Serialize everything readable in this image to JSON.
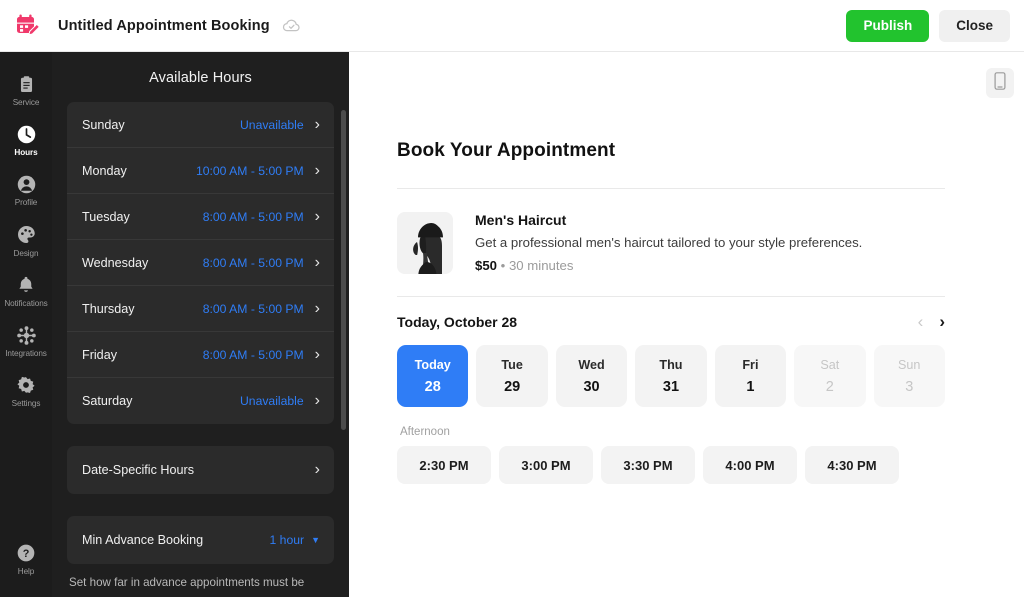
{
  "topbar": {
    "logo_icon": "calendar-edit-icon",
    "title": "Untitled Appointment Booking",
    "saved_icon": "cloud-check-icon",
    "publish_label": "Publish",
    "close_label": "Close",
    "publish_color": "#22c32e"
  },
  "rail": {
    "items": [
      {
        "label": "Service",
        "icon": "clipboard-icon",
        "active": false
      },
      {
        "label": "Hours",
        "icon": "clock-icon",
        "active": true
      },
      {
        "label": "Profile",
        "icon": "person-icon",
        "active": false
      },
      {
        "label": "Design",
        "icon": "palette-icon",
        "active": false
      },
      {
        "label": "Notifications",
        "icon": "bell-icon",
        "active": false
      },
      {
        "label": "Integrations",
        "icon": "integrations-icon",
        "active": false
      },
      {
        "label": "Settings",
        "icon": "gear-icon",
        "active": false
      }
    ],
    "help": {
      "label": "Help",
      "icon": "question-circle-icon"
    }
  },
  "panel": {
    "title": "Available Hours",
    "days": [
      {
        "name": "Sunday",
        "value": "Unavailable"
      },
      {
        "name": "Monday",
        "value": "10:00 AM - 5:00 PM"
      },
      {
        "name": "Tuesday",
        "value": "8:00 AM - 5:00 PM"
      },
      {
        "name": "Wednesday",
        "value": "8:00 AM - 5:00 PM"
      },
      {
        "name": "Thursday",
        "value": "8:00 AM - 5:00 PM"
      },
      {
        "name": "Friday",
        "value": "8:00 AM - 5:00 PM"
      },
      {
        "name": "Saturday",
        "value": "Unavailable"
      }
    ],
    "date_specific": {
      "label": "Date-Specific Hours"
    },
    "min_advance": {
      "label": "Min Advance Booking",
      "value": "1 hour"
    },
    "note": "Set how far in advance appointments must be",
    "accent_color": "#2f7df6"
  },
  "preview": {
    "device_icon": "mobile-icon",
    "heading": "Book Your Appointment",
    "service": {
      "photo_icon": "person-profile-photo",
      "name": "Men's Haircut",
      "description": "Get a professional men's haircut tailored to your style preferences.",
      "price": "$50",
      "separator": " • ",
      "duration": "30 minutes"
    },
    "date_section": {
      "title": "Today, October 28",
      "prev_icon": "chevron-left-icon",
      "next_icon": "chevron-right-icon",
      "dates": [
        {
          "dow": "Today",
          "day": "28",
          "state": "selected"
        },
        {
          "dow": "Tue",
          "day": "29",
          "state": "available"
        },
        {
          "dow": "Wed",
          "day": "30",
          "state": "available"
        },
        {
          "dow": "Thu",
          "day": "31",
          "state": "available"
        },
        {
          "dow": "Fri",
          "day": "1",
          "state": "available"
        },
        {
          "dow": "Sat",
          "day": "2",
          "state": "disabled"
        },
        {
          "dow": "Sun",
          "day": "3",
          "state": "disabled"
        }
      ],
      "selected_color": "#2f7df6"
    },
    "slots_label": "Afternoon",
    "slots": [
      "2:30 PM",
      "3:00 PM",
      "3:30 PM",
      "4:00 PM",
      "4:30 PM"
    ]
  }
}
